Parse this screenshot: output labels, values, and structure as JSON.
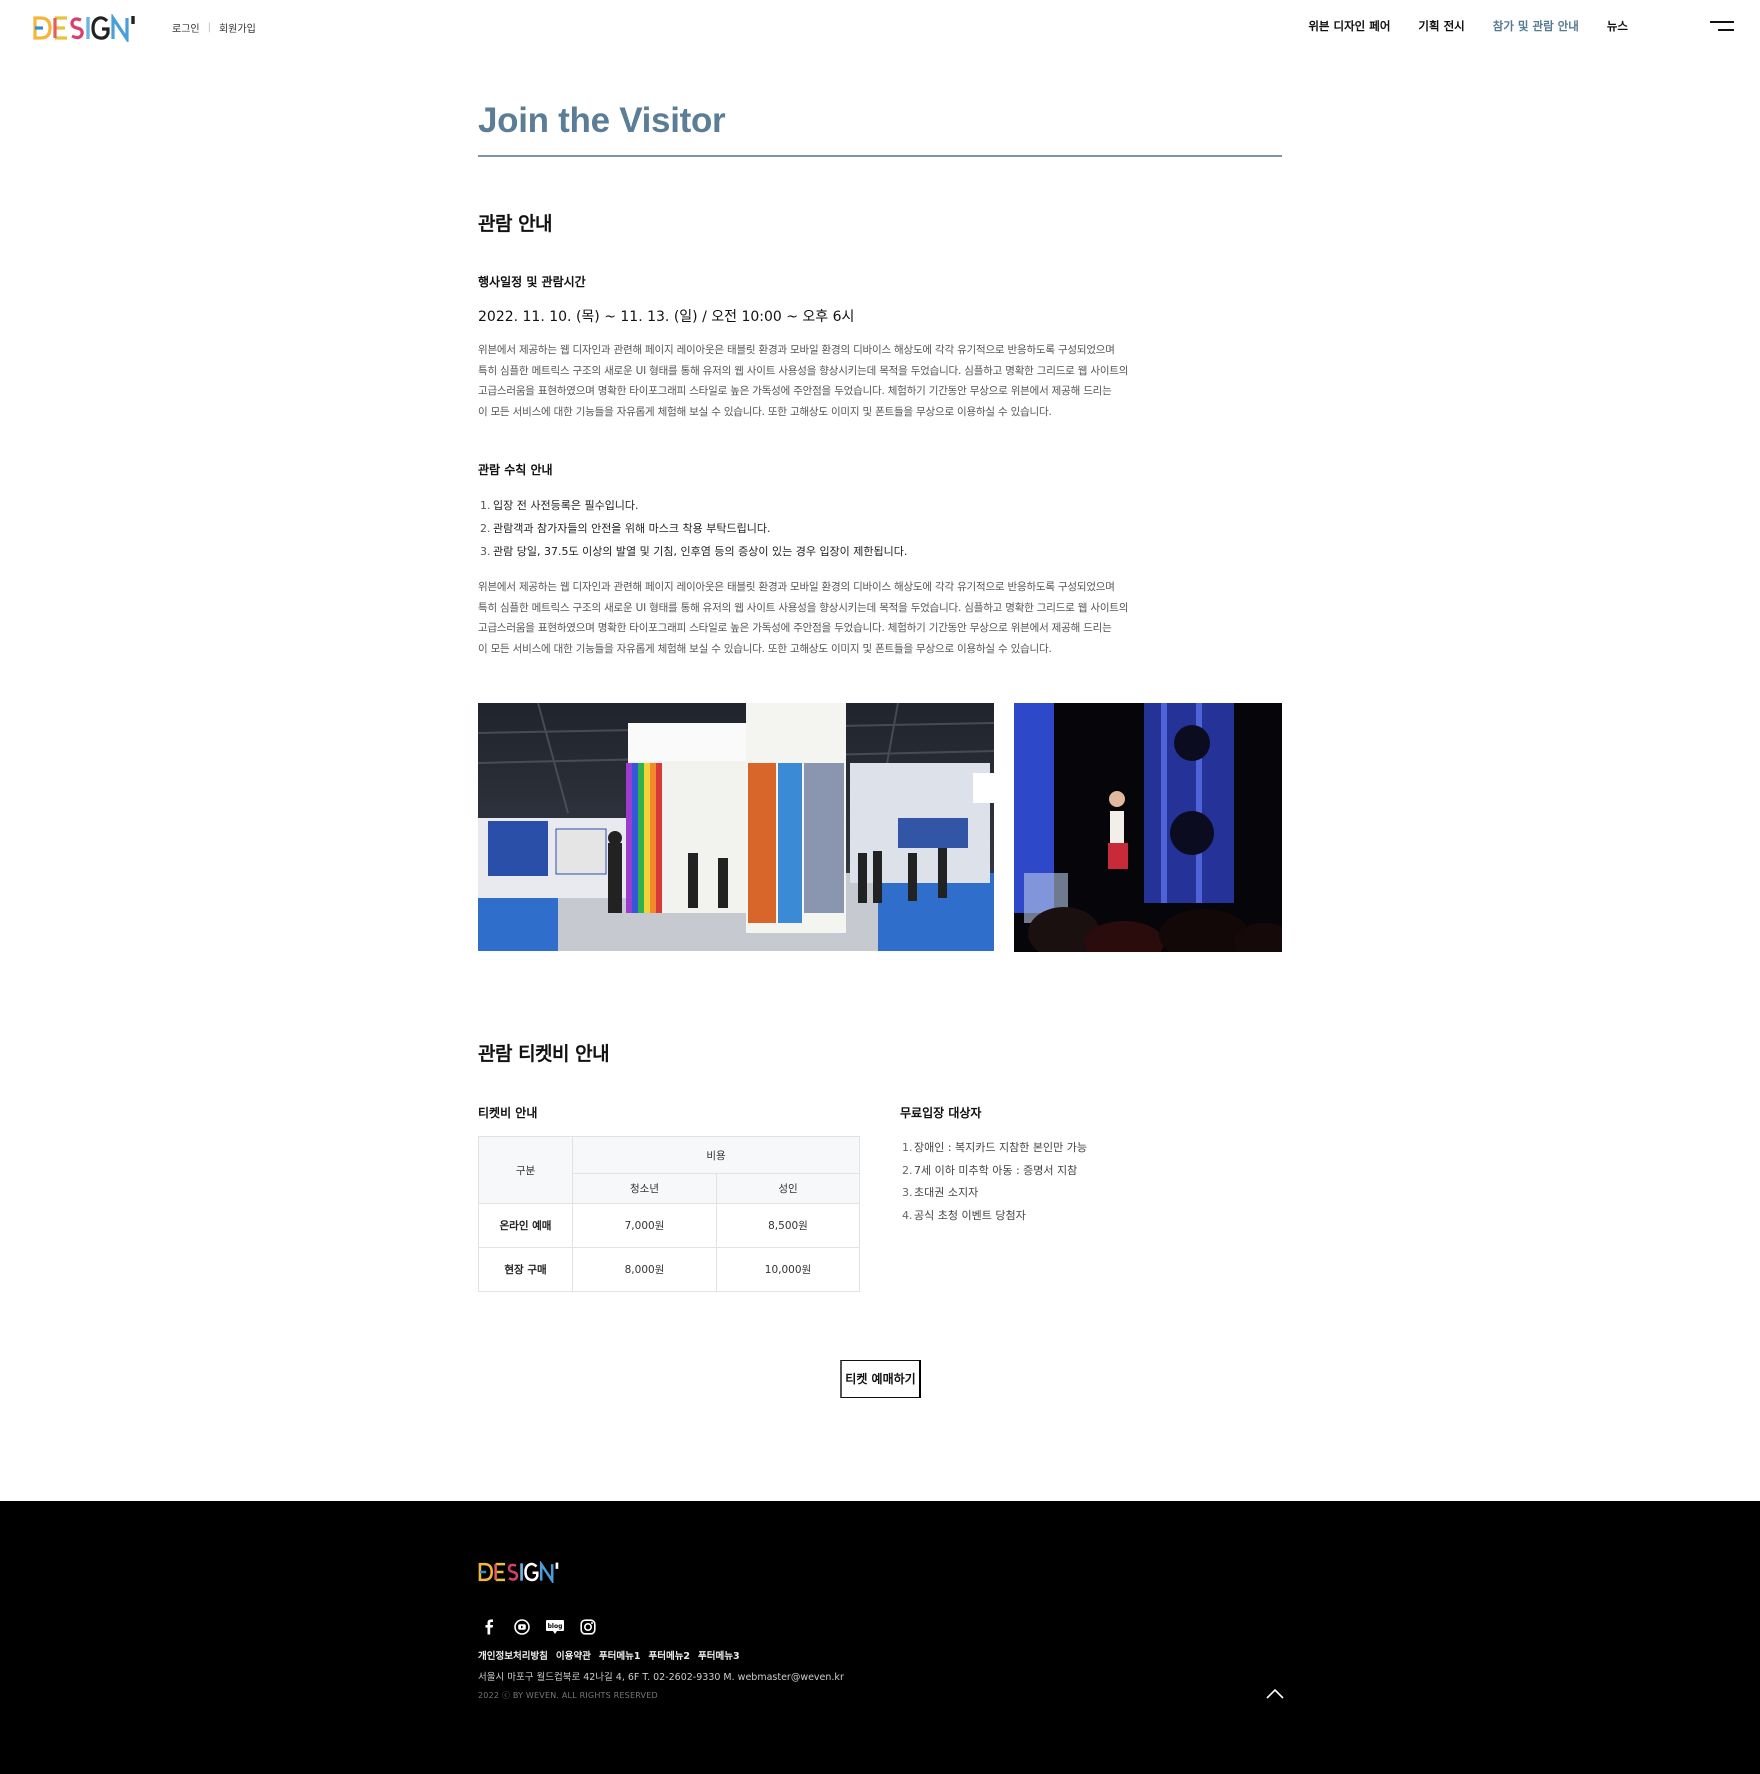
{
  "brand": {
    "logo_text": "DESIGN"
  },
  "auth": {
    "login": "로그인",
    "signup": "회원가입",
    "separator": "|"
  },
  "nav": {
    "items": [
      {
        "label": "위븐 디자인 페어"
      },
      {
        "label": "기획 전시"
      },
      {
        "label": "참가 및 관람 안내",
        "active": true
      },
      {
        "label": "뉴스"
      }
    ],
    "menu_icon": "hamburger-icon"
  },
  "page": {
    "title": "Join the Visitor"
  },
  "visit": {
    "heading": "관람 안내",
    "schedule_heading": "행사일정 및 관람시간",
    "schedule_text": "2022. 11. 10. (목) ~ 11. 13. (일)  /   오전 10:00 ~ 오후 6시",
    "description_lines": [
      "위븐에서 제공하는 웹 디자인과 관련해 페이지 레이아웃은 태블릿 환경과 모바일 환경의 디바이스 해상도에 각각 유기적으로 반응하도록 구성되었으며",
      "특히 심플한 메트릭스 구조의 새로운 UI 형태를 통해 유저의 웹 사이트 사용성을 향상시키는데 목적을 두었습니다. 심플하고 명확한 그리드로 웹 사이트의",
      "고급스러움을 표현하였으며 명확한 타이포그래피 스타일로 높은 가독성에 주안점을 두었습니다. 체험하기 기간동안 무상으로 위븐에서 제공해 드리는",
      "이 모든 서비스에 대한 기능들을 자유롭게 체험해 보실 수 있습니다. 또한 고해상도 이미지 및 폰트들을 무상으로 이용하실 수 있습니다."
    ],
    "rules_heading": "관람 수칙 안내",
    "rules": [
      {
        "num": "1.",
        "text": "입장 전 사전등록은 필수입니다."
      },
      {
        "num": "2.",
        "text": "관람객과 참가자들의 안전을 위해 마스크 착용 부탁드립니다."
      },
      {
        "num": "3.",
        "text": "관람 당일, 37.5도 이상의 발열 및 기침, 인후염 등의 증상이 있는 경우 입장이 제한됩니다."
      }
    ],
    "description2_lines": [
      "위븐에서 제공하는 웹 디자인과 관련해 페이지 레이아웃은 태블릿 환경과 모바일 환경의 디바이스 해상도에 각각 유기적으로 반응하도록 구성되었으며",
      "특히 심플한 메트릭스 구조의 새로운 UI 형태를 통해 유저의 웹 사이트 사용성을 향상시키는데 목적을 두었습니다. 심플하고 명확한 그리드로 웹 사이트의",
      "고급스러움을 표현하였으며 명확한 타이포그래피 스타일로 높은 가독성에 주안점을 두었습니다. 체험하기 기간동안 무상으로 위븐에서 제공해 드리는",
      "이 모든 서비스에 대한 기능들을 자유롭게 체험해 보실 수 있습니다. 또한 고해상도 이미지 및 폰트들을 무상으로 이용하실 수 있습니다."
    ]
  },
  "ticket": {
    "heading": "관람 티켓비 안내",
    "table_heading": "티켓비 안내",
    "table": {
      "col_category": "구분",
      "col_cost": "비용",
      "col_youth": "청소년",
      "col_adult": "성인",
      "rows": [
        {
          "label": "온라인 예매",
          "youth": "7,000원",
          "adult": "8,500원"
        },
        {
          "label": "현장 구매",
          "youth": "8,000원",
          "adult": "10,000원"
        }
      ]
    },
    "free_heading": "무료입장 대상자",
    "free_list": [
      {
        "num": "1.",
        "text": "장애인 : 복지카드 지참한 본인만 가능"
      },
      {
        "num": "2.",
        "text": "7세 이하 미추학 아동 : 증명서 지참"
      },
      {
        "num": "3.",
        "text": "초대권 소지자"
      },
      {
        "num": "4.",
        "text": "공식 초청 이벤트 당첨자"
      }
    ],
    "button_label": "티켓 예매하기"
  },
  "footer": {
    "logo_text": "DESIGN",
    "sns": [
      "facebook-icon",
      "youtube-icon",
      "blog-icon",
      "instagram-icon"
    ],
    "blog_label": "blog",
    "links": [
      "개인정보처리방침",
      "이용약관",
      "푸터메뉴1",
      "푸터메뉴2",
      "푸터메뉴3"
    ],
    "address": "서울시 마포구 월드컵북로 42나길 4, 6F   T. 02-2602-9330 M. webmaster@weven.kr",
    "copyright": "2022 ⓒ BY WEVEN. ALL RIGHTS RESERVED"
  },
  "colors": {
    "accent": "#5b7d95",
    "footer_bg": "#000000"
  }
}
